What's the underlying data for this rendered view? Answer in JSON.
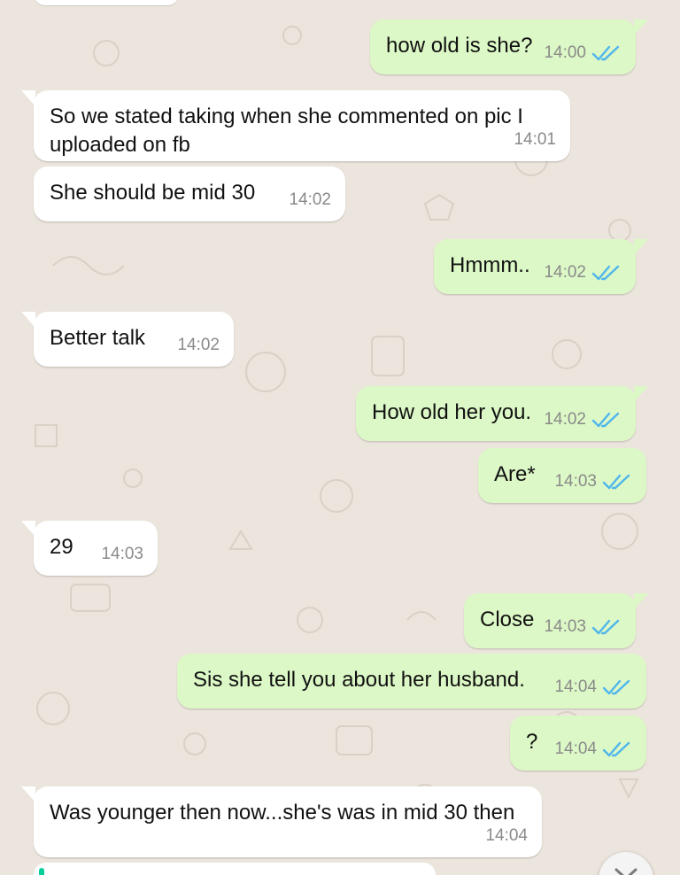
{
  "colors": {
    "wallpaper": "#ece5dd",
    "incoming_bubble": "#ffffff",
    "outgoing_bubble": "#dcf8c6",
    "read_ticks": "#4fb6ec",
    "timestamp": "#8a8a8a"
  },
  "messages": [
    {
      "direction": "out",
      "text": "how old is she?",
      "time": "14:00",
      "status_icon": "double-check-read-icon"
    },
    {
      "direction": "in",
      "text": "So we stated taking when she commented on pic I\nuploaded on fb",
      "time": "14:01"
    },
    {
      "direction": "in",
      "text": "She should be mid 30",
      "time": "14:02"
    },
    {
      "direction": "out",
      "text": "Hmmm..",
      "time": "14:02",
      "status_icon": "double-check-read-icon"
    },
    {
      "direction": "in",
      "text": "Better talk",
      "time": "14:02"
    },
    {
      "direction": "out",
      "text": "How old her you.",
      "time": "14:02",
      "status_icon": "double-check-read-icon"
    },
    {
      "direction": "out",
      "text": "Are*",
      "time": "14:03",
      "status_icon": "double-check-read-icon"
    },
    {
      "direction": "in",
      "text": "29",
      "time": "14:03"
    },
    {
      "direction": "out",
      "text": "Close",
      "time": "14:03",
      "status_icon": "double-check-read-icon"
    },
    {
      "direction": "out",
      "text": "Sis she tell you about her husband.",
      "time": "14:04",
      "status_icon": "double-check-read-icon"
    },
    {
      "direction": "out",
      "text": "?",
      "time": "14:04",
      "status_icon": "double-check-read-icon"
    },
    {
      "direction": "in",
      "text": "Was younger then now...she's was in mid 30 then",
      "time": "14:04"
    }
  ],
  "scroll_down_button": {
    "icon": "chevron-down-icon"
  }
}
